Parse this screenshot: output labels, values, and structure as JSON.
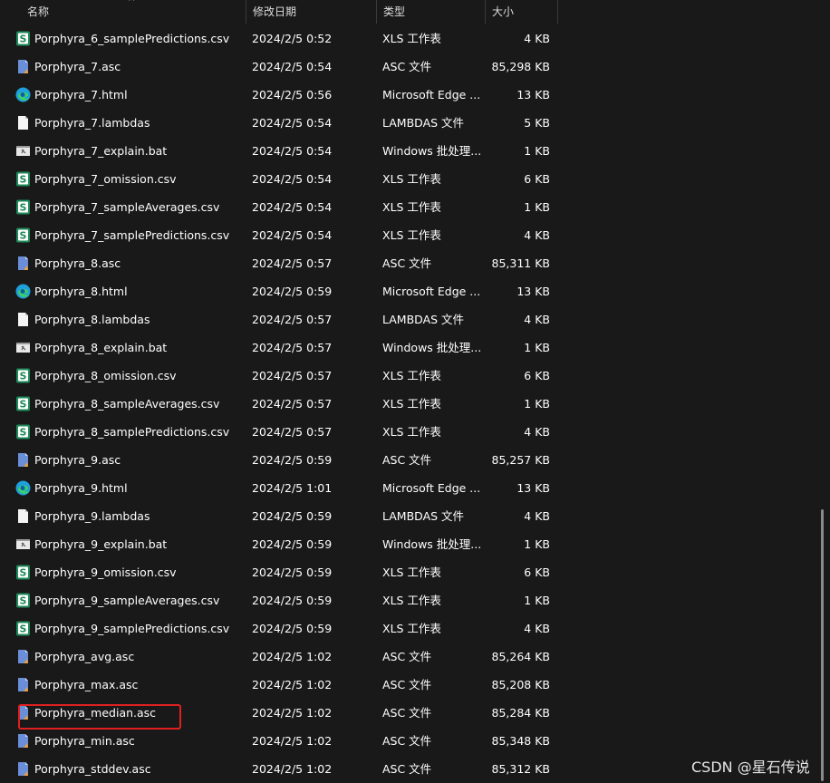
{
  "columns": {
    "name": "名称",
    "date": "修改日期",
    "type": "类型",
    "size": "大小"
  },
  "colors": {
    "background": "#191919",
    "highlight_box": "#e02020",
    "csv_icon": "#1f8a5a",
    "edge_icon": "#1ea0dc"
  },
  "files": [
    {
      "name": "Porphyra_6_samplePredictions.csv",
      "date": "2024/2/5 0:52",
      "type": "XLS 工作表",
      "size": "4 KB",
      "icon": "csv-icon"
    },
    {
      "name": "Porphyra_7.asc",
      "date": "2024/2/5 0:54",
      "type": "ASC 文件",
      "size": "85,298 KB",
      "icon": "asc-file-icon"
    },
    {
      "name": "Porphyra_7.html",
      "date": "2024/2/5 0:56",
      "type": "Microsoft Edge ...",
      "size": "13 KB",
      "icon": "edge-icon"
    },
    {
      "name": "Porphyra_7.lambdas",
      "date": "2024/2/5 0:54",
      "type": "LAMBDAS 文件",
      "size": "5 KB",
      "icon": "blank-file-icon"
    },
    {
      "name": "Porphyra_7_explain.bat",
      "date": "2024/2/5 0:54",
      "type": "Windows 批处理...",
      "size": "1 KB",
      "icon": "bat-icon"
    },
    {
      "name": "Porphyra_7_omission.csv",
      "date": "2024/2/5 0:54",
      "type": "XLS 工作表",
      "size": "6 KB",
      "icon": "csv-icon"
    },
    {
      "name": "Porphyra_7_sampleAverages.csv",
      "date": "2024/2/5 0:54",
      "type": "XLS 工作表",
      "size": "1 KB",
      "icon": "csv-icon"
    },
    {
      "name": "Porphyra_7_samplePredictions.csv",
      "date": "2024/2/5 0:54",
      "type": "XLS 工作表",
      "size": "4 KB",
      "icon": "csv-icon"
    },
    {
      "name": "Porphyra_8.asc",
      "date": "2024/2/5 0:57",
      "type": "ASC 文件",
      "size": "85,311 KB",
      "icon": "asc-file-icon"
    },
    {
      "name": "Porphyra_8.html",
      "date": "2024/2/5 0:59",
      "type": "Microsoft Edge ...",
      "size": "13 KB",
      "icon": "edge-icon"
    },
    {
      "name": "Porphyra_8.lambdas",
      "date": "2024/2/5 0:57",
      "type": "LAMBDAS 文件",
      "size": "4 KB",
      "icon": "blank-file-icon"
    },
    {
      "name": "Porphyra_8_explain.bat",
      "date": "2024/2/5 0:57",
      "type": "Windows 批处理...",
      "size": "1 KB",
      "icon": "bat-icon"
    },
    {
      "name": "Porphyra_8_omission.csv",
      "date": "2024/2/5 0:57",
      "type": "XLS 工作表",
      "size": "6 KB",
      "icon": "csv-icon"
    },
    {
      "name": "Porphyra_8_sampleAverages.csv",
      "date": "2024/2/5 0:57",
      "type": "XLS 工作表",
      "size": "1 KB",
      "icon": "csv-icon"
    },
    {
      "name": "Porphyra_8_samplePredictions.csv",
      "date": "2024/2/5 0:57",
      "type": "XLS 工作表",
      "size": "4 KB",
      "icon": "csv-icon"
    },
    {
      "name": "Porphyra_9.asc",
      "date": "2024/2/5 0:59",
      "type": "ASC 文件",
      "size": "85,257 KB",
      "icon": "asc-file-icon"
    },
    {
      "name": "Porphyra_9.html",
      "date": "2024/2/5 1:01",
      "type": "Microsoft Edge ...",
      "size": "13 KB",
      "icon": "edge-icon"
    },
    {
      "name": "Porphyra_9.lambdas",
      "date": "2024/2/5 0:59",
      "type": "LAMBDAS 文件",
      "size": "4 KB",
      "icon": "blank-file-icon"
    },
    {
      "name": "Porphyra_9_explain.bat",
      "date": "2024/2/5 0:59",
      "type": "Windows 批处理...",
      "size": "1 KB",
      "icon": "bat-icon"
    },
    {
      "name": "Porphyra_9_omission.csv",
      "date": "2024/2/5 0:59",
      "type": "XLS 工作表",
      "size": "6 KB",
      "icon": "csv-icon"
    },
    {
      "name": "Porphyra_9_sampleAverages.csv",
      "date": "2024/2/5 0:59",
      "type": "XLS 工作表",
      "size": "1 KB",
      "icon": "csv-icon"
    },
    {
      "name": "Porphyra_9_samplePredictions.csv",
      "date": "2024/2/5 0:59",
      "type": "XLS 工作表",
      "size": "4 KB",
      "icon": "csv-icon"
    },
    {
      "name": "Porphyra_avg.asc",
      "date": "2024/2/5 1:02",
      "type": "ASC 文件",
      "size": "85,264 KB",
      "icon": "asc-file-icon"
    },
    {
      "name": "Porphyra_max.asc",
      "date": "2024/2/5 1:02",
      "type": "ASC 文件",
      "size": "85,208 KB",
      "icon": "asc-file-icon"
    },
    {
      "name": "Porphyra_median.asc",
      "date": "2024/2/5 1:02",
      "type": "ASC 文件",
      "size": "85,284 KB",
      "icon": "asc-file-icon"
    },
    {
      "name": "Porphyra_min.asc",
      "date": "2024/2/5 1:02",
      "type": "ASC 文件",
      "size": "85,348 KB",
      "icon": "asc-file-icon"
    },
    {
      "name": "Porphyra_stddev.asc",
      "date": "2024/2/5 1:02",
      "type": "ASC 文件",
      "size": "85,312 KB",
      "icon": "asc-file-icon"
    }
  ],
  "watermark": "CSDN @星石传说"
}
